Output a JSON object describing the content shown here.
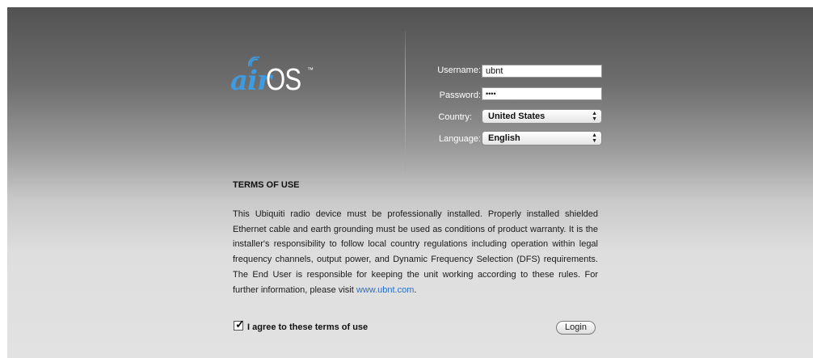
{
  "logo": {
    "air": "air",
    "os": "OS",
    "tm": "™"
  },
  "form": {
    "username_label": "Username:",
    "username_value": "ubnt",
    "password_label": "Password:",
    "password_value": "••••",
    "country_label": "Country:",
    "country_value": "United States",
    "language_label": "Language:",
    "language_value": "English"
  },
  "terms": {
    "title": "TERMS OF USE",
    "body": "This Ubiquiti radio device must be professionally installed. Properly installed shielded Ethernet cable and earth grounding must be used as conditions of product warranty. It is the installer's responsibility to follow local country regulations including operation within legal frequency channels, output power, and Dynamic Frequency Selection (DFS) requirements. The End User is responsible for keeping the unit working according to these rules. For further information, please visit ",
    "link_text": "www.ubnt.com",
    "body_end": "."
  },
  "agree": {
    "label": "I agree to these terms of use",
    "checked": true
  },
  "login_label": "Login",
  "colors": {
    "accent": "#3f9be0",
    "link": "#2a6fc9"
  },
  "icons": {
    "logo_wave": "wifi-wave-icon",
    "select_arrows": "updown-arrows-icon",
    "checkbox": "checkmark-icon"
  }
}
